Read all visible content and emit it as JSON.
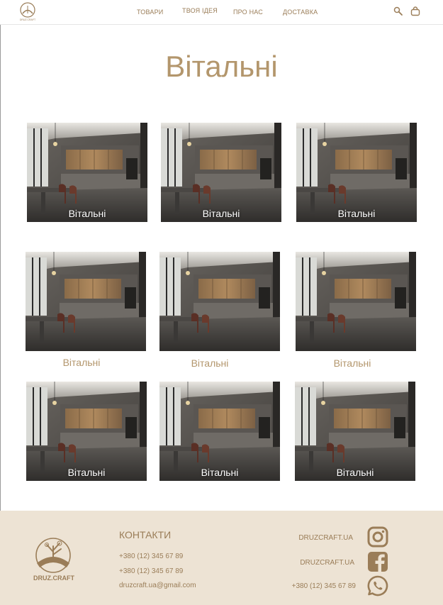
{
  "header": {
    "logo_text": "DRUZ.CRAFT",
    "nav": [
      {
        "label": "ТОВАРИ"
      },
      {
        "label": "ТВОЯ ІДЕЯ"
      },
      {
        "label": "ПРО НАС"
      },
      {
        "label": "ДОСТАВКА"
      }
    ],
    "icons": [
      "search-icon",
      "bag-icon"
    ]
  },
  "main": {
    "title": "Вітальні",
    "cards": [
      {
        "label": "Вітальні"
      },
      {
        "label": "Вітальні"
      },
      {
        "label": "Вітальні"
      },
      {
        "label": "Вітальні"
      },
      {
        "label": "Вітальні"
      },
      {
        "label": "Вітальні"
      },
      {
        "label": "Вітальні"
      },
      {
        "label": "Вітальні"
      },
      {
        "label": "Вітальні"
      }
    ]
  },
  "footer": {
    "brand": "DRUZ.CRAFT",
    "contacts_title": "КОНТАКТИ",
    "phone_1": "+380 (12) 345 67 89",
    "phone_2": "+380 (12) 345 67 89",
    "email": "druzcraft.ua@gmail.com",
    "social": [
      {
        "label": "DRUZCRAFT.UA",
        "icon": "instagram-icon"
      },
      {
        "label": "DRUZCRAFT.UA",
        "icon": "facebook-icon"
      },
      {
        "label": "+380 (12) 345 67 89",
        "icon": "whatsapp-icon"
      }
    ]
  },
  "colors": {
    "accent": "#9a7d58",
    "title": "#b3966c",
    "footer_bg": "#ede3d4"
  }
}
